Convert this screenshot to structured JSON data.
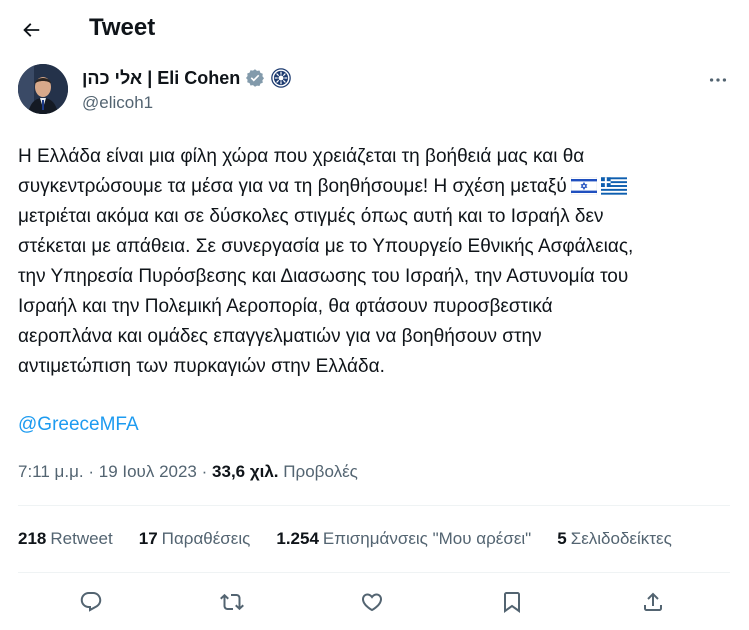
{
  "header": {
    "title": "Tweet",
    "back_icon": "arrow-left-icon"
  },
  "author": {
    "display_name": "אלי כהן | Eli Cohen",
    "handle": "@elicoh1",
    "verified_icon": "verified-badge-icon",
    "affiliation_icon": "government-affiliation-icon",
    "more_icon": "more-horizontal-icon"
  },
  "tweet": {
    "lines": [
      "Η Ελλάδα είναι μια φίλη  χώρα που χρειάζεται τη βοήθειά μας και θα",
      "συγκεντρώσουμε τα μέσα για να τη βοηθήσουμε! Η σχέση μεταξύ",
      "μετριέται ακόμα και σε δύσκολες στιγμές όπως αυτή και το Ισραήλ δεν",
      "στέκεται με απάθεια. Σε συνεργασία με το Υπουργείο Εθνικής Ασφάλειας,",
      "την Υπηρεσία Πυρόσβεσης και Διασωσης του Ισραήλ, την Αστυνομία του",
      "Ισραήλ και την Πολεμική Αεροπορία, θα φτάσουν πυροσβεστικά",
      "αεροπλάνα και ομάδες επαγγελματιών για να βοηθήσουν στην",
      "αντιμετώπιση των πυρκαγιών στην Ελλάδα."
    ],
    "flags": [
      "israel-flag-icon",
      "greece-flag-icon"
    ],
    "mention": "@GreeceMFA"
  },
  "meta": {
    "time": "7:11 μ.μ.",
    "separator": "·",
    "date": "19 Ιουλ 2023",
    "views_count": "33,6 χιλ.",
    "views_label": "Προβολές"
  },
  "stats": [
    {
      "count": "218",
      "label": "Retweet"
    },
    {
      "count": "17",
      "label": "Παραθέσεις"
    },
    {
      "count": "1.254",
      "label": "Επισημάνσεις \"Μου αρέσει\""
    },
    {
      "count": "5",
      "label": "Σελιδοδείκτες"
    }
  ],
  "actions": [
    "reply-icon",
    "retweet-icon",
    "like-icon",
    "bookmark-icon",
    "share-icon"
  ],
  "colors": {
    "text": "#0f1419",
    "secondary": "#536471",
    "accent": "#1d9bf0",
    "divider": "#eff3f4"
  }
}
